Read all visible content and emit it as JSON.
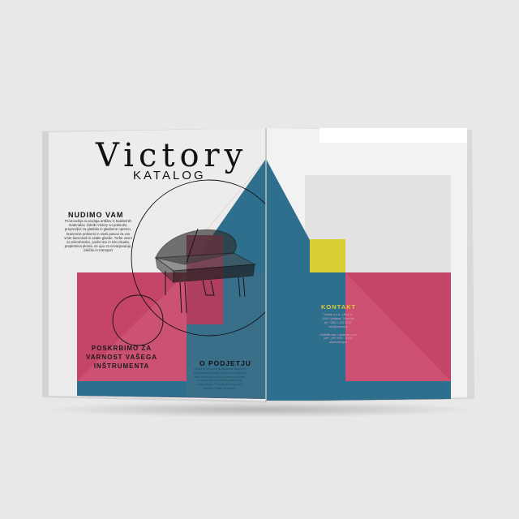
{
  "catalog": {
    "title": "Victory",
    "subtitle": "KATALOG"
  },
  "intro": {
    "heading": "NUDIMO VAM",
    "body": "Proizvodnja in prodaja artiklov iz kvalitetnih materialov. Izdelki Victory so poknolni, preprezljivi za glasbila in glasbene opremo, hranennie prilinemi in natiri pasovi za vse vrste barnoiodi in ostale glasbe. Torbe vesni za mikrofonske, povlicnice in tolo ekuala, prepletnica ploma, ne upo za ozvanjevanje, zakčito in transport"
  },
  "care": {
    "heading": "POSKRBIMO ZA VARNOST VAŠEGA INŠTRUMENTA"
  },
  "about": {
    "heading": "O PODJETJU",
    "body": "Victory je priznana ekskluzivna blagovna znamka kakovostnih izdelkov za glasbila, naše torbe in kovčki so izdelani po meri in dizajnirani za zaščito glasbil pred poškodbami. Ponosni smo na naše izdelke in našo strankam."
  },
  "contact": {
    "heading": "KONTAKT",
    "lines": [
      "Victory d.o.o., Ulica 12",
      "1000 Ljubljana, Slovenija",
      "tel: +386 1 123 45 67",
      "info@victory.si",
      "",
      "Obiščite nas v delovnih urah",
      "pon - pet: 8:00 - 16:00",
      "www.victory.si"
    ]
  },
  "colors": {
    "crimson": "#a9324f",
    "rose": "#c74669",
    "teal": "#2d6f8c",
    "yellow": "#d8cf35",
    "paper": "#ececec"
  }
}
